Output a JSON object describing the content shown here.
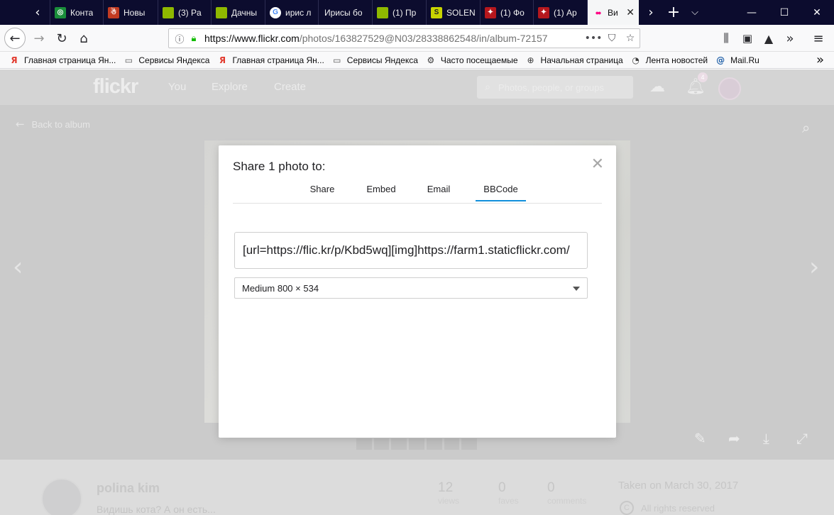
{
  "browser": {
    "tabs": [
      {
        "title": "Конта",
        "favicon_color": "#1a8e3a",
        "favicon_glyph": "◎"
      },
      {
        "title": "Новы",
        "favicon_color": "#c23b22",
        "favicon_glyph": "☃"
      },
      {
        "title": "(3) Pa",
        "favicon_color": "#8fb800",
        "favicon_glyph": ""
      },
      {
        "title": "Дачны",
        "favicon_color": "#8fb800",
        "favicon_glyph": ""
      },
      {
        "title": "ирис л",
        "favicon_color": "#ffffff",
        "favicon_glyph": "G"
      },
      {
        "title": "Ирисы бо",
        "favicon_color": "",
        "favicon_glyph": ""
      },
      {
        "title": "(1) Пр",
        "favicon_color": "#8fb800",
        "favicon_glyph": ""
      },
      {
        "title": "SOLEN",
        "favicon_color": "#c8d400",
        "favicon_glyph": "S"
      },
      {
        "title": "(1) Фо",
        "favicon_color": "#b5171d",
        "favicon_glyph": "✦"
      },
      {
        "title": "(1) Ар",
        "favicon_color": "#b5171d",
        "favicon_glyph": "✦"
      },
      {
        "title": "Ви",
        "favicon_color": "#ff0084",
        "favicon_glyph": "●●"
      }
    ],
    "address": {
      "host": "https://www.flickr.com",
      "path": "/photos/163827529@N03/28338862548/in/album-72157",
      "more": "•••"
    },
    "bookmarks": [
      {
        "label": "Главная страница Ян...",
        "icon": "yandex-icon",
        "glyph": "Я"
      },
      {
        "label": "Сервисы Яндекса",
        "icon": "folder-icon",
        "glyph": "▭"
      },
      {
        "label": "Главная страница Ян...",
        "icon": "yandex-icon",
        "glyph": "Я"
      },
      {
        "label": "Сервисы Яндекса",
        "icon": "folder-icon",
        "glyph": "▭"
      },
      {
        "label": "Часто посещаемые",
        "icon": "gear-icon",
        "glyph": "⚙"
      },
      {
        "label": "Начальная страница",
        "icon": "globe-icon",
        "glyph": "⊕"
      },
      {
        "label": "Лента новостей",
        "icon": "rss-icon",
        "glyph": "◔"
      },
      {
        "label": "Mail.Ru",
        "icon": "at-icon",
        "glyph": "@"
      }
    ]
  },
  "flickr": {
    "logo": "flickr",
    "nav": [
      "You",
      "Explore",
      "Create"
    ],
    "search_placeholder": "Photos, people, or groups",
    "notification_count": "4",
    "back_link": "Back to album",
    "owner_name": "polina kim",
    "description": "Видишь кота? А он есть...",
    "stats": [
      {
        "value": "12",
        "label": "views"
      },
      {
        "value": "0",
        "label": "faves"
      },
      {
        "value": "0",
        "label": "comments"
      }
    ],
    "taken": "Taken on March 30, 2017",
    "rights": "All rights reserved",
    "rights_icon_glyph": "C"
  },
  "share_modal": {
    "title": "Share 1 photo to:",
    "tabs": [
      "Share",
      "Embed",
      "Email",
      "BBCode"
    ],
    "active_tab": "BBCode",
    "code": "[url=https://flic.kr/p/Kbd5wq][img]https://farm1.staticflickr.com/",
    "size_option": "Medium 800 × 534"
  },
  "colors": {
    "tabbar": "#0c0c2e",
    "flickr_pink": "#ff0084",
    "flickr_blue": "#0063dc",
    "active_tab_underline": "#128fdc"
  }
}
